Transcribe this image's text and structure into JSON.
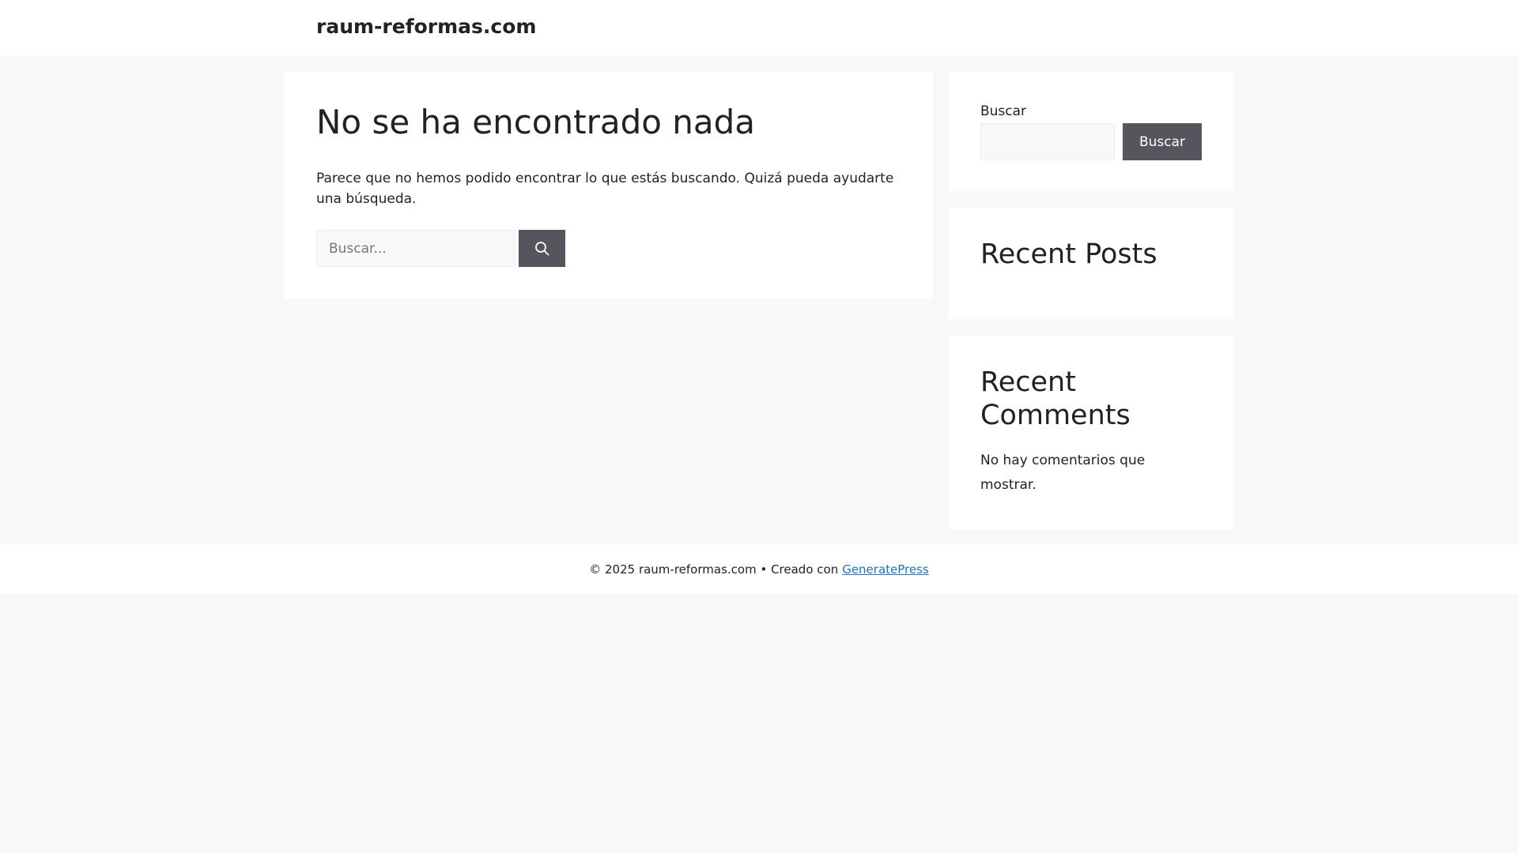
{
  "header": {
    "site_title": "raum-reformas.com"
  },
  "main": {
    "title": "No se ha encontrado nada",
    "message": "Parece que no hemos podido encontrar lo que estás buscando. Quizá pueda ayudarte una búsqueda.",
    "search_placeholder": "Buscar...",
    "search_button_icon": "search-icon"
  },
  "sidebar": {
    "search_label": "Buscar",
    "search_button": "Buscar",
    "recent_posts_title": "Recent Posts",
    "recent_comments_title": "Recent Comments",
    "no_comments": "No hay comentarios que mostrar."
  },
  "footer": {
    "copyright": "© 2025 raum-reformas.com • Creado con",
    "link": "GeneratePress"
  }
}
